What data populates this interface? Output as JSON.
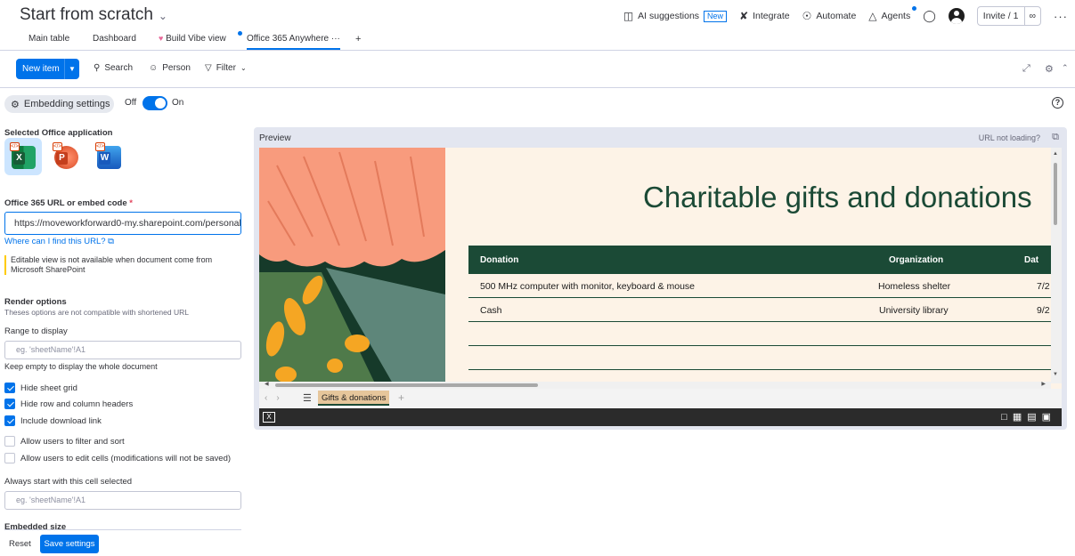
{
  "header": {
    "title": "Start from scratch",
    "ai_label": "AI suggestions",
    "ai_badge": "New",
    "integrate": "Integrate",
    "automate": "Automate",
    "agents": "Agents",
    "invite": "Invite / 1"
  },
  "tabs": [
    {
      "label": "Main table"
    },
    {
      "label": "Dashboard"
    },
    {
      "label": "Build Vibe view"
    },
    {
      "label": "Office 365 Anywhere"
    }
  ],
  "toolbar": {
    "new_item": "New item",
    "search": "Search",
    "person": "Person",
    "filter": "Filter"
  },
  "embedding": {
    "button": "Embedding settings",
    "off": "Off",
    "on": "On"
  },
  "settings": {
    "selected_app_label": "Selected Office application",
    "apps": [
      "X",
      "P",
      "W"
    ],
    "url_label": "Office 365 URL or embed code",
    "required": "*",
    "url_value": "https://moveworkforward0-my.sharepoint.com/personal",
    "find_url": "Where can I find this URL?",
    "note": "Editable view is not available when document come from Microsoft SharePoint",
    "render_label": "Render options",
    "render_sub": "Theses options are not compatible with shortened URL",
    "range_label": "Range to display",
    "range_placeholder": "eg. 'sheetName'!A1",
    "range_help": "Keep empty to display the whole document",
    "checkboxes": [
      {
        "label": "Hide sheet grid",
        "checked": true
      },
      {
        "label": "Hide row and column headers",
        "checked": true
      },
      {
        "label": "Include download link",
        "checked": true
      },
      {
        "label": "Allow users to filter and sort",
        "checked": false
      },
      {
        "label": "Allow users to edit cells (modifications will not be saved)",
        "checked": false
      }
    ],
    "start_cell_label": "Always start with this cell selected",
    "start_cell_placeholder": "eg. 'sheetName'!A1",
    "embedded_size": "Embedded size",
    "reset": "Reset",
    "save": "Save settings"
  },
  "preview": {
    "label": "Preview",
    "url_not_loading": "URL not loading?",
    "sheet_title": "Charitable gifts and donations",
    "columns": [
      "Donation",
      "Organization",
      "Dat"
    ],
    "rows": [
      [
        "500 MHz computer with monitor, keyboard & mouse",
        "Homeless shelter",
        "7/2"
      ],
      [
        "Cash",
        "University library",
        "9/2"
      ]
    ],
    "sheet_tab": "Gifts & donations"
  },
  "colors": {
    "accent": "#0073ea",
    "sheet_green": "#1b4a36",
    "sheet_bg": "#fdf3e7"
  }
}
